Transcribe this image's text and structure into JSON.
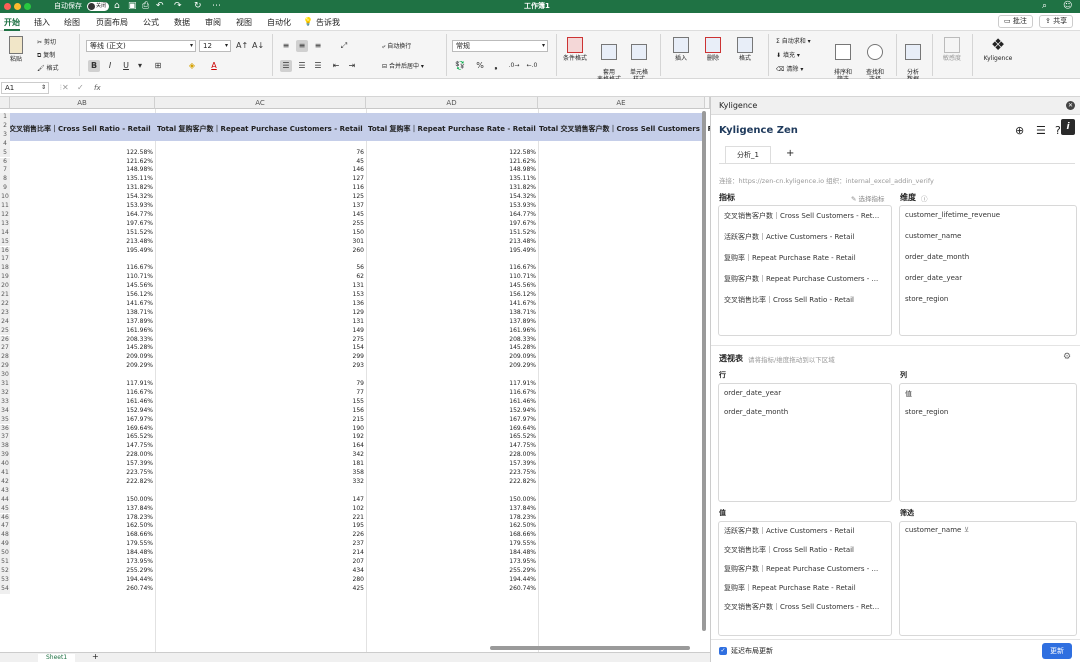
{
  "window": {
    "autosave_label": "自动保存",
    "autosave_state": "关闭",
    "title": "工作簿1"
  },
  "menu": {
    "tabs": [
      "开始",
      "插入",
      "绘图",
      "页面布局",
      "公式",
      "数据",
      "审阅",
      "视图",
      "自动化"
    ],
    "tell_me": "告诉我",
    "comments_label": "批注",
    "share_label": "共享"
  },
  "ribbon": {
    "paste": "粘贴",
    "cut": "剪切",
    "copy": "复制",
    "format_painter": "格式",
    "font_name": "等线 (正文)",
    "font_size": "12",
    "wrap_text": "自动换行",
    "merge_center": "合并后居中",
    "number_format": "常规",
    "conditional_format": "条件格式",
    "format_as_table": "套用\n表格格式",
    "cell_styles": "单元格\n样式",
    "insert": "插入",
    "delete": "删除",
    "format": "格式",
    "autosum": "自动求和",
    "fill": "填充",
    "clear": "清除",
    "sort_filter": "排序和\n筛选",
    "find_select": "查找和\n选择",
    "analyze_data": "分析\n数据",
    "sensitivity": "敏感度",
    "kyligence": "Kyligence",
    "bold": "B",
    "italic": "I",
    "underline": "U"
  },
  "formula_bar": {
    "name_box": "A1",
    "fx": "fx",
    "formula": ""
  },
  "grid": {
    "columns": [
      "AB",
      "AC",
      "AD",
      "AE"
    ],
    "header_row": [
      "交叉销售比率｜Cross Sell Ratio - Retail",
      "Total 复购客户数｜Repeat Purchase Customers - Retail",
      "Total 复购率｜Repeat Purchase Rate - Retail",
      "Total 交叉销售客户数｜Cross Sell Customers - Retail"
    ],
    "row_numbers": [
      "1",
      "2",
      "3",
      "4",
      "5",
      "6",
      "7",
      "8",
      "9",
      "10",
      "11",
      "12",
      "13",
      "14",
      "15",
      "16",
      "17",
      "18",
      "19",
      "20",
      "21",
      "22",
      "23",
      "24",
      "25",
      "26",
      "27",
      "28",
      "29",
      "30",
      "31",
      "32",
      "33",
      "34",
      "35",
      "36",
      "37",
      "38",
      "39",
      "40",
      "41",
      "42",
      "43",
      "44",
      "45",
      "46",
      "47",
      "48",
      "49",
      "50",
      "51",
      "52",
      "53",
      "54"
    ],
    "rows": [
      [
        "",
        "",
        ""
      ],
      [
        "",
        "",
        ""
      ],
      [
        "",
        "",
        ""
      ],
      [
        "",
        "",
        ""
      ],
      [
        "122.58%",
        "76",
        "122.58%"
      ],
      [
        "121.62%",
        "45",
        "121.62%"
      ],
      [
        "148.98%",
        "146",
        "148.98%"
      ],
      [
        "135.11%",
        "127",
        "135.11%"
      ],
      [
        "131.82%",
        "116",
        "131.82%"
      ],
      [
        "154.32%",
        "125",
        "154.32%"
      ],
      [
        "153.93%",
        "137",
        "153.93%"
      ],
      [
        "164.77%",
        "145",
        "164.77%"
      ],
      [
        "197.67%",
        "255",
        "197.67%"
      ],
      [
        "151.52%",
        "150",
        "151.52%"
      ],
      [
        "213.48%",
        "301",
        "213.48%"
      ],
      [
        "195.49%",
        "260",
        "195.49%"
      ],
      [
        "",
        "",
        ""
      ],
      [
        "116.67%",
        "56",
        "116.67%"
      ],
      [
        "110.71%",
        "62",
        "110.71%"
      ],
      [
        "145.56%",
        "131",
        "145.56%"
      ],
      [
        "156.12%",
        "153",
        "156.12%"
      ],
      [
        "141.67%",
        "136",
        "141.67%"
      ],
      [
        "138.71%",
        "129",
        "138.71%"
      ],
      [
        "137.89%",
        "131",
        "137.89%"
      ],
      [
        "161.96%",
        "149",
        "161.96%"
      ],
      [
        "208.33%",
        "275",
        "208.33%"
      ],
      [
        "145.28%",
        "154",
        "145.28%"
      ],
      [
        "209.09%",
        "299",
        "209.09%"
      ],
      [
        "209.29%",
        "293",
        "209.29%"
      ],
      [
        "",
        "",
        ""
      ],
      [
        "117.91%",
        "79",
        "117.91%"
      ],
      [
        "116.67%",
        "77",
        "116.67%"
      ],
      [
        "161.46%",
        "155",
        "161.46%"
      ],
      [
        "152.94%",
        "156",
        "152.94%"
      ],
      [
        "167.97%",
        "215",
        "167.97%"
      ],
      [
        "169.64%",
        "190",
        "169.64%"
      ],
      [
        "165.52%",
        "192",
        "165.52%"
      ],
      [
        "147.75%",
        "164",
        "147.75%"
      ],
      [
        "228.00%",
        "342",
        "228.00%"
      ],
      [
        "157.39%",
        "181",
        "157.39%"
      ],
      [
        "223.75%",
        "358",
        "223.75%"
      ],
      [
        "222.82%",
        "332",
        "222.82%"
      ],
      [
        "",
        "",
        ""
      ],
      [
        "150.00%",
        "147",
        "150.00%"
      ],
      [
        "137.84%",
        "102",
        "137.84%"
      ],
      [
        "178.23%",
        "221",
        "178.23%"
      ],
      [
        "162.50%",
        "195",
        "162.50%"
      ],
      [
        "168.66%",
        "226",
        "168.66%"
      ],
      [
        "179.55%",
        "237",
        "179.55%"
      ],
      [
        "184.48%",
        "214",
        "184.48%"
      ],
      [
        "173.95%",
        "207",
        "173.95%"
      ],
      [
        "255.29%",
        "434",
        "255.29%"
      ],
      [
        "194.44%",
        "280",
        "194.44%"
      ],
      [
        "260.74%",
        "425",
        "260.74%"
      ]
    ],
    "sheet_tab": "Sheet1",
    "add_sheet": "+"
  },
  "panel": {
    "header_title": "Kyligence",
    "app_name": "Kyligence Zen",
    "tab_label": "分析_1",
    "add_tab": "+",
    "connection_label": "连接：",
    "connection_url": "https://zen-cn.kyligence.io",
    "org_label": "组织：",
    "org_value": "internal_excel_addin_verify",
    "metrics_title": "指标",
    "select_metric": "选择指标",
    "metrics": [
      "交叉销售客户数｜Cross Sell Customers - Ret...",
      "活跃客户数｜Active Customers - Retail",
      "复购率｜Repeat Purchase Rate - Retail",
      "复购客户数｜Repeat Purchase Customers - ...",
      "交叉销售比率｜Cross Sell Ratio - Retail"
    ],
    "dimensions_title": "维度",
    "dimensions": [
      "customer_lifetime_revenue",
      "customer_name",
      "order_date_month",
      "order_date_year",
      "store_region"
    ],
    "pivot_title": "透视表",
    "pivot_hint": "请将指标/维度拖动到以下区域",
    "rows_title": "行",
    "rows": [
      "order_date_year",
      "order_date_month"
    ],
    "columns_title": "列",
    "columns": [
      "值",
      "store_region"
    ],
    "values_title": "值",
    "values": [
      "活跃客户数｜Active Customers - Retail",
      "交叉销售比率｜Cross Sell Ratio - Retail",
      "复购客户数｜Repeat Purchase Customers - ...",
      "复购率｜Repeat Purchase Rate - Retail",
      "交叉销售客户数｜Cross Sell Customers - Ret..."
    ],
    "filters_title": "筛选",
    "filters": [
      "customer_name"
    ],
    "defer_label": "延迟布局更新",
    "update_button": "更新"
  }
}
